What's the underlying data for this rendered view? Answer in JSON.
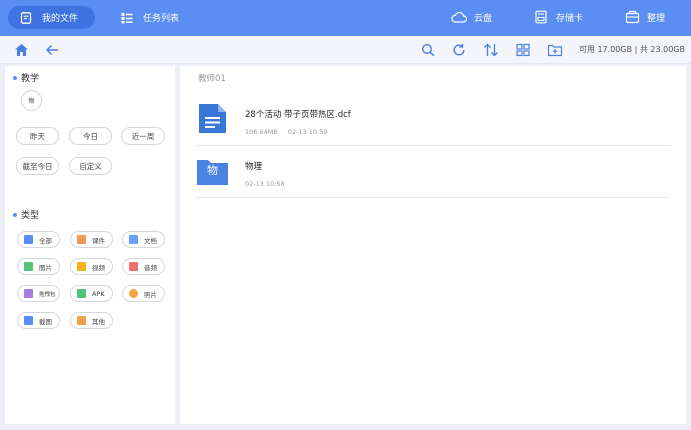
{
  "topbar": {
    "tabs": [
      {
        "label": "我的文件",
        "active": true,
        "icon": "document-icon"
      },
      {
        "label": "任务列表",
        "active": false,
        "icon": "list-icon"
      }
    ],
    "tools": [
      {
        "label": "云盘",
        "icon": "cloud-icon"
      },
      {
        "label": "存储卡",
        "icon": "sd-card-icon"
      },
      {
        "label": "整理",
        "icon": "organize-icon"
      }
    ]
  },
  "subbar": {
    "storage_text": "可用 17.00GB | 共 23.00GB",
    "icons": [
      "home-icon",
      "back-arrow-icon",
      "search-icon",
      "refresh-icon",
      "sort-icon",
      "view-toggle-icon",
      "import-icon"
    ]
  },
  "sidebar": {
    "teaching_title": "教学",
    "subject_chip": "物",
    "time_filters": [
      "昨天",
      "今日",
      "近一周",
      "截至今日",
      "自定义"
    ],
    "type_title": "类型",
    "types": [
      {
        "label": "全部",
        "icon": "grid-icon",
        "color": "#5b8ef2"
      },
      {
        "label": "课件",
        "icon": "courseware-icon",
        "color": "#f39a5a"
      },
      {
        "label": "文档",
        "icon": "doc-icon",
        "color": "#6aa0f5"
      },
      {
        "label": "图片",
        "icon": "image-icon",
        "color": "#58c27a"
      },
      {
        "label": "视频",
        "icon": "video-icon",
        "color": "#f2b31c"
      },
      {
        "label": "音频",
        "icon": "audio-icon",
        "color": "#f07070"
      },
      {
        "label": "拖拽包",
        "icon": "package-icon",
        "color": "#a57be6"
      },
      {
        "label": "APK",
        "icon": "apk-icon",
        "color": "#4cc27c"
      },
      {
        "label": "照片",
        "icon": "photo-icon",
        "color": "#f3a53b"
      },
      {
        "label": "截图",
        "icon": "crop-icon",
        "color": "#5b8ef2"
      },
      {
        "label": "其他",
        "icon": "folder-icon",
        "color": "#f0a24a"
      }
    ]
  },
  "main": {
    "folder_title": "教师01",
    "files": [
      {
        "name": "28个活动 带子页带热区.dcf",
        "size": "106.64MB",
        "date": "02-13 10:59",
        "icon": "document-file-icon"
      },
      {
        "name": "物理",
        "size": "",
        "date": "02-13 10:58",
        "icon": "folder-icon",
        "badge": "物"
      }
    ]
  },
  "colors": {
    "accent": "#5b8ef2",
    "accent_dark": "#3f74e0"
  }
}
